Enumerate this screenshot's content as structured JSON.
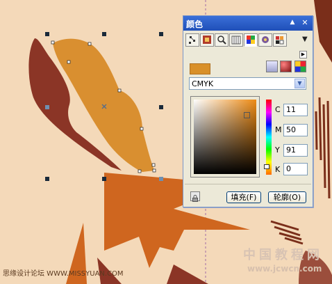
{
  "panel": {
    "title": "颜色",
    "tabs": [
      "color-viewer",
      "color-blend",
      "color-mixer",
      "palette",
      "color-model",
      "image-color",
      "grid"
    ],
    "active_tab": 4,
    "color_model": "CMYK",
    "cmyk": [
      {
        "label": "C",
        "value": "11"
      },
      {
        "label": "M",
        "value": "50"
      },
      {
        "label": "Y",
        "value": "91"
      },
      {
        "label": "K",
        "value": "0"
      }
    ],
    "fill_button": "填充(F)",
    "outline_button": "轮廓(O)",
    "swatch_color": "#d99029"
  },
  "watermark": {
    "left": "思缘设计论坛 WWW.MISSYUAN.COM",
    "right_title": "中国教程网",
    "right_url": "www.jcwcn.com"
  },
  "colors": {
    "background": "#f4d9b9",
    "dark_leaf": "#8b3526",
    "light_leaf": "#d98f30",
    "orange_shape": "#cf661f",
    "dark_stripes": "#7a2e1a"
  }
}
